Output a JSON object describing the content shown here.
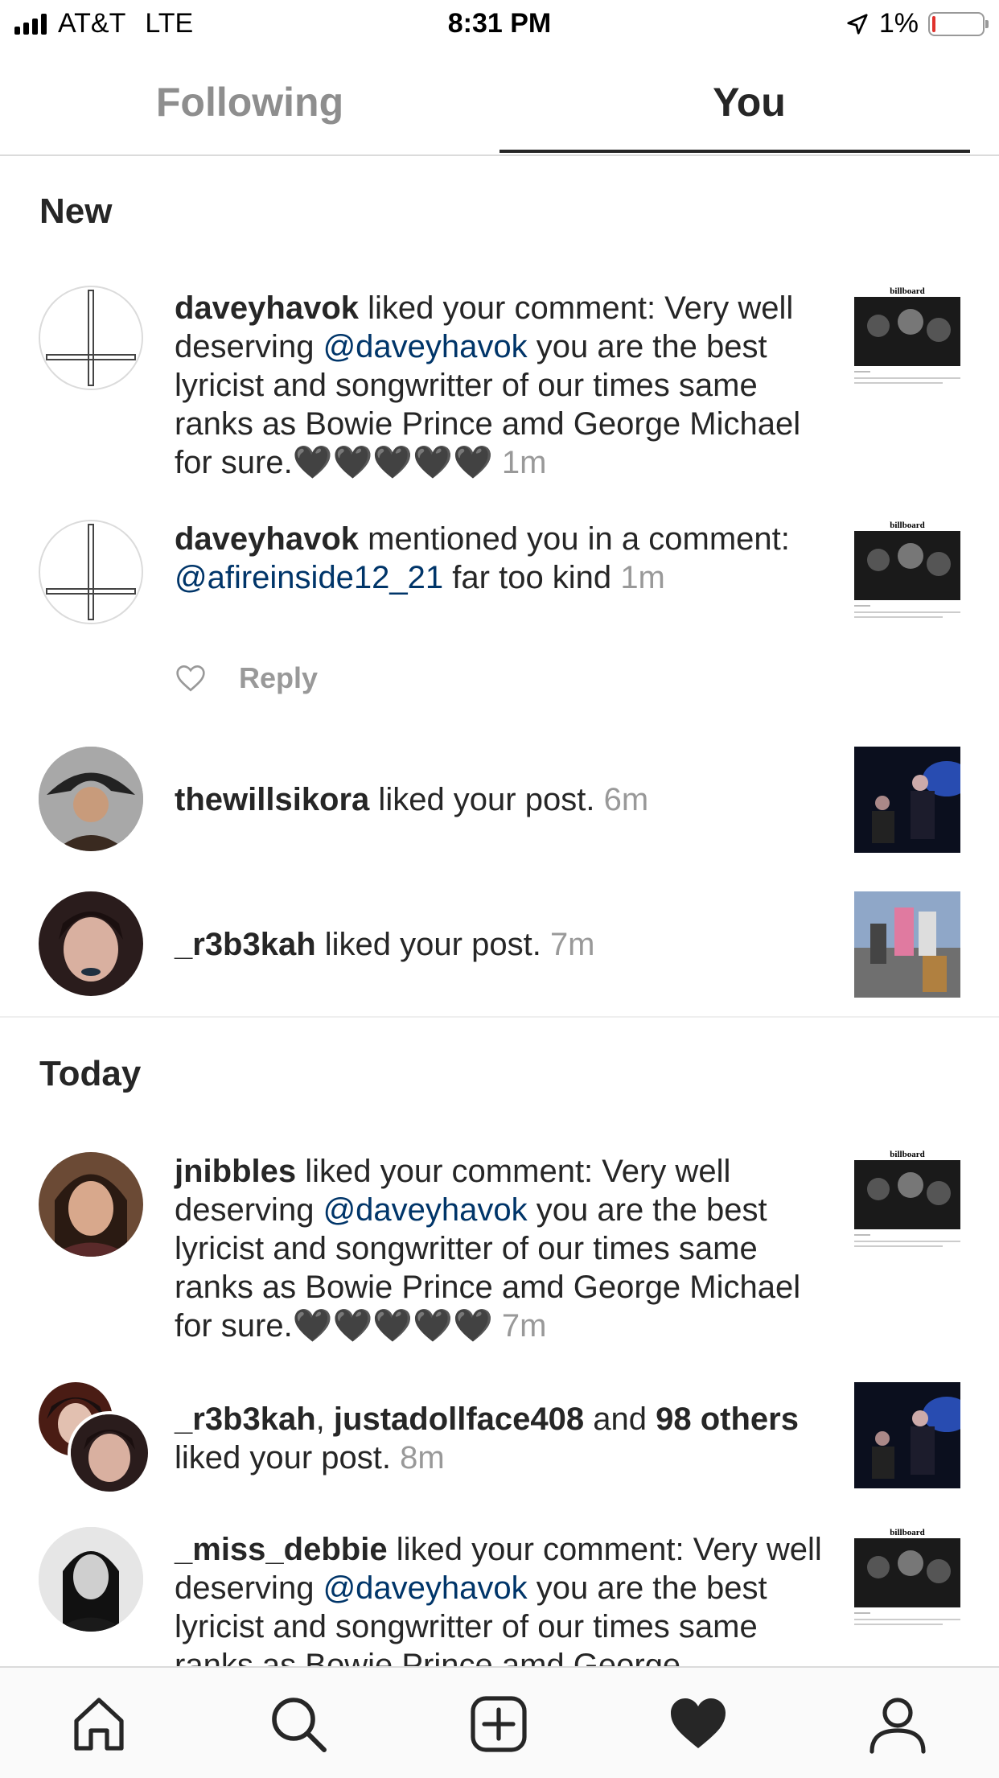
{
  "status_bar": {
    "carrier": "AT&T",
    "network": "LTE",
    "time": "8:31 PM",
    "battery_percent": "1%",
    "battery_level": 0.01
  },
  "tabs": [
    {
      "label": "Following"
    },
    {
      "label": "You"
    }
  ],
  "sections": {
    "new": "New",
    "today": "Today"
  },
  "notifications": {
    "n1": {
      "user": "daveyhavok",
      "action": " liked your comment: Very well deserving ",
      "mention": "@daveyhavok",
      "rest": "  you are the best lyricist and songwritter of our times same ranks as Bowie Prince amd George Michael for sure.",
      "hearts": "🖤🖤🖤🖤🖤",
      "time": "1m"
    },
    "n2": {
      "user": "daveyhavok",
      "action": " mentioned you in a comment: ",
      "mention": "@afireinside12_21",
      "rest": " far too kind",
      "time": "1m",
      "reply_label": "Reply"
    },
    "n3": {
      "user": "thewillsikora",
      "action": " liked your post.",
      "time": "6m"
    },
    "n4": {
      "user": "_r3b3kah",
      "action": " liked your post.",
      "time": "7m"
    },
    "n5": {
      "user": "jnibbles",
      "action": " liked your comment: Very well deserving ",
      "mention": "@daveyhavok",
      "rest": "  you are the best lyricist and songwritter of our times same ranks as Bowie Prince amd George Michael for sure.",
      "hearts": "🖤🖤🖤🖤🖤",
      "time": "7m"
    },
    "n6": {
      "user1": "_r3b3kah",
      "sep": ", ",
      "user2": "justadollface408",
      "and": " and ",
      "others": "98 others",
      "action": " liked your post.",
      "time": "8m"
    },
    "n7": {
      "user": "_miss_debbie",
      "action": " liked your comment: Very well deserving ",
      "mention": "@daveyhavok",
      "rest": "  you are the best lyricist and songwritter of our times same ranks as Bowie Prince amd George"
    }
  },
  "thumb_masthead": "billboard",
  "bottom_nav": [
    "home-icon",
    "search-icon",
    "new-post-icon",
    "activity-heart-icon",
    "profile-icon"
  ]
}
